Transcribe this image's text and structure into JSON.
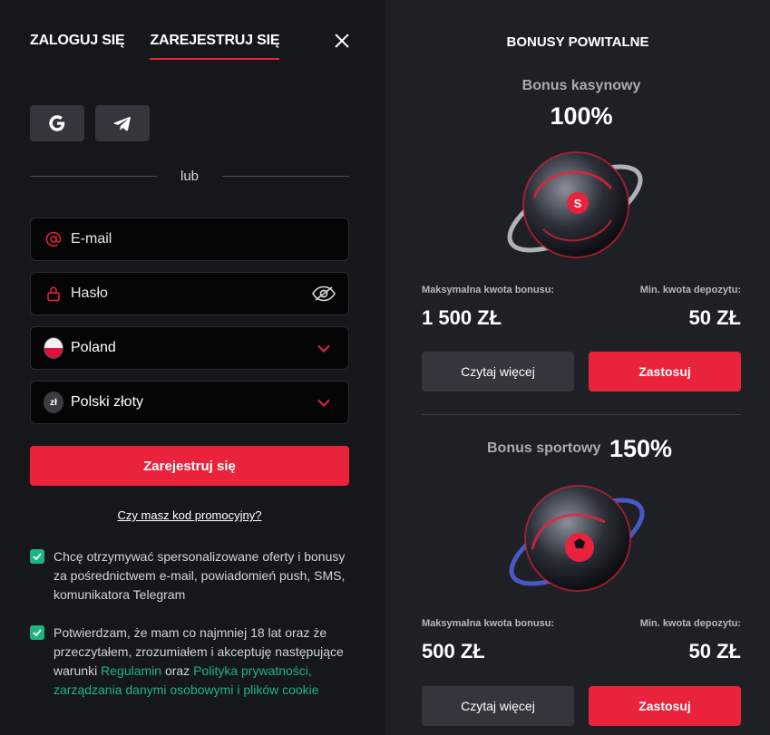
{
  "auth": {
    "tabs": [
      {
        "label": "ZALOGUJ SIĘ"
      },
      {
        "label": "ZAREJESTRUJ SIĘ"
      }
    ],
    "divider_text": "lub",
    "fields": {
      "email": "E-mail",
      "password": "Hasło",
      "country": "Poland",
      "currency": "Polski złoty",
      "currency_icon": "zł"
    },
    "submit_label": "Zarejestruj się",
    "promo_link": "Czy masz kod promocyjny?",
    "consent_marketing": "Chcę otrzymywać spersonalizowane oferty i bonusy za pośrednictwem e-mail, powiadomień push, SMS, komunikatora Telegram",
    "consent_terms": {
      "prefix": "Potwierdzam, że mam co najmniej 18 lat oraz że przeczytałem, zrozumiałem i akceptuję następujące warunki ",
      "link1": "Regulamin",
      "middle": " oraz ",
      "link2": "Polityka prywatności, zarządzania danymi osobowymi i plików cookie"
    },
    "colors": {
      "accent": "#e8233b",
      "check": "#1eb482"
    }
  },
  "bonuses": {
    "title": "BONUSY POWITALNE",
    "items": [
      {
        "subtitle": "Bonus kasynowy",
        "percent": "100%",
        "max_label": "Maksymalna kwota bonusu:",
        "max_value": "1 500 ZŁ",
        "min_label": "Min. kwota depozytu:",
        "min_value": "50 ZŁ",
        "read_more": "Czytaj więcej",
        "apply": "Zastosuj"
      },
      {
        "subtitle": "Bonus sportowy",
        "percent": "150%",
        "max_label": "Maksymalna kwota bonusu:",
        "max_value": "500 ZŁ",
        "min_label": "Min. kwota depozytu:",
        "min_value": "50 ZŁ",
        "read_more": "Czytaj więcej",
        "apply": "Zastosuj"
      }
    ]
  }
}
